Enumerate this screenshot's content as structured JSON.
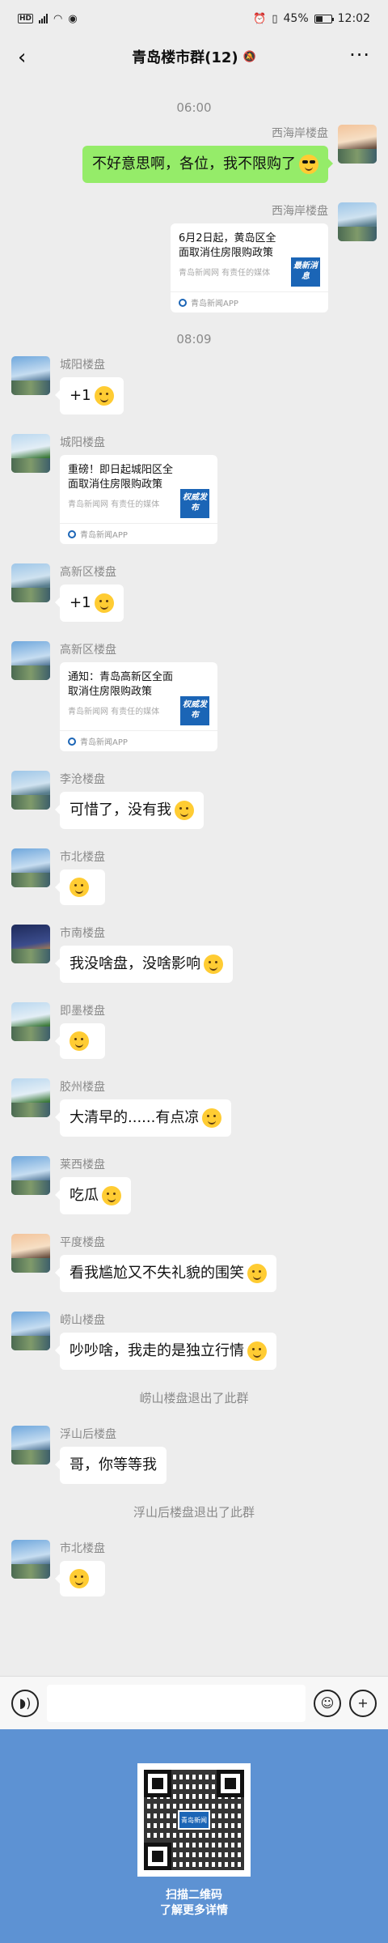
{
  "status_bar": {
    "hd": "HD",
    "network": "4G",
    "battery": "45%",
    "battery_level": 0.45,
    "time": "12:02"
  },
  "header": {
    "title": "青岛楼市群(12)",
    "back_icon": "chevron-left-icon",
    "mute_icon": "bell-muted-icon",
    "more_icon": "more-icon"
  },
  "chat": {
    "time_1": "06:00",
    "time_2": "08:09",
    "messages": [
      {
        "side": "right",
        "sender": "西海岸楼盘",
        "text": "不好意思啊，各位，我不限购了",
        "emoji": "sunglasses"
      },
      {
        "side": "right",
        "sender": "西海岸楼盘",
        "card_title": "6月2日起，黄岛区全面取消住房限购政策",
        "card_sub": "青岛新闻网 有责任的媒体",
        "card_thumb": "最新消息",
        "card_foot": "青岛新闻APP"
      },
      {
        "side": "left",
        "sender": "城阳楼盘",
        "text": "+1",
        "emoji": "grin"
      },
      {
        "side": "left",
        "sender": "城阳楼盘",
        "card_title": "重磅！即日起城阳区全面取消住房限购政策",
        "card_sub": "青岛新闻网 有责任的媒体",
        "card_thumb": "权威发布",
        "card_foot": "青岛新闻APP"
      },
      {
        "side": "left",
        "sender": "高新区楼盘",
        "text": "+1",
        "emoji": "smile"
      },
      {
        "side": "left",
        "sender": "高新区楼盘",
        "card_title": "通知：青岛高新区全面取消住房限购政策",
        "card_sub": "青岛新闻网 有责任的媒体",
        "card_thumb": "权威发布",
        "card_foot": "青岛新闻APP"
      },
      {
        "side": "left",
        "sender": "李沧楼盘",
        "text": "可惜了，没有我",
        "emoji": "sad"
      },
      {
        "side": "left",
        "sender": "市北楼盘",
        "text": "",
        "emoji": "relieved"
      },
      {
        "side": "left",
        "sender": "市南楼盘",
        "text": "我没啥盘，没啥影响",
        "emoji": "smirk"
      },
      {
        "side": "left",
        "sender": "即墨楼盘",
        "text": "",
        "emoji": "meh"
      },
      {
        "side": "left",
        "sender": "胶州楼盘",
        "text": "大清早的......有点凉",
        "emoji": "cold"
      },
      {
        "side": "left",
        "sender": "莱西楼盘",
        "text": "吃瓜",
        "emoji": "melon"
      },
      {
        "side": "left",
        "sender": "平度楼盘",
        "text": "看我尴尬又不失礼貌的围笑",
        "emoji": "awkward"
      },
      {
        "side": "left",
        "sender": "崂山楼盘",
        "text": "吵吵啥，我走的是独立行情",
        "emoji": "cowboy"
      }
    ],
    "system_1": "崂山楼盘退出了此群",
    "messages_2": [
      {
        "side": "left",
        "sender": "浮山后楼盘",
        "text": "哥，你等等我"
      }
    ],
    "system_2": "浮山后楼盘退出了此群",
    "messages_3": [
      {
        "side": "left",
        "sender": "市北楼盘",
        "text": "",
        "emoji": "shy"
      }
    ]
  },
  "input_bar": {
    "voice_icon": "voice-icon",
    "emoji_icon": "emoji-icon",
    "plus_icon": "plus-icon",
    "placeholder": ""
  },
  "promo": {
    "qr_label": "青岛新闻",
    "line_1": "扫描二维码",
    "line_2": "了解更多详情"
  },
  "colors": {
    "accent_bubble": "#95ec69",
    "background": "#ededed",
    "promo_bg": "#5d92d3",
    "card_thumb": "#1b65b6"
  }
}
